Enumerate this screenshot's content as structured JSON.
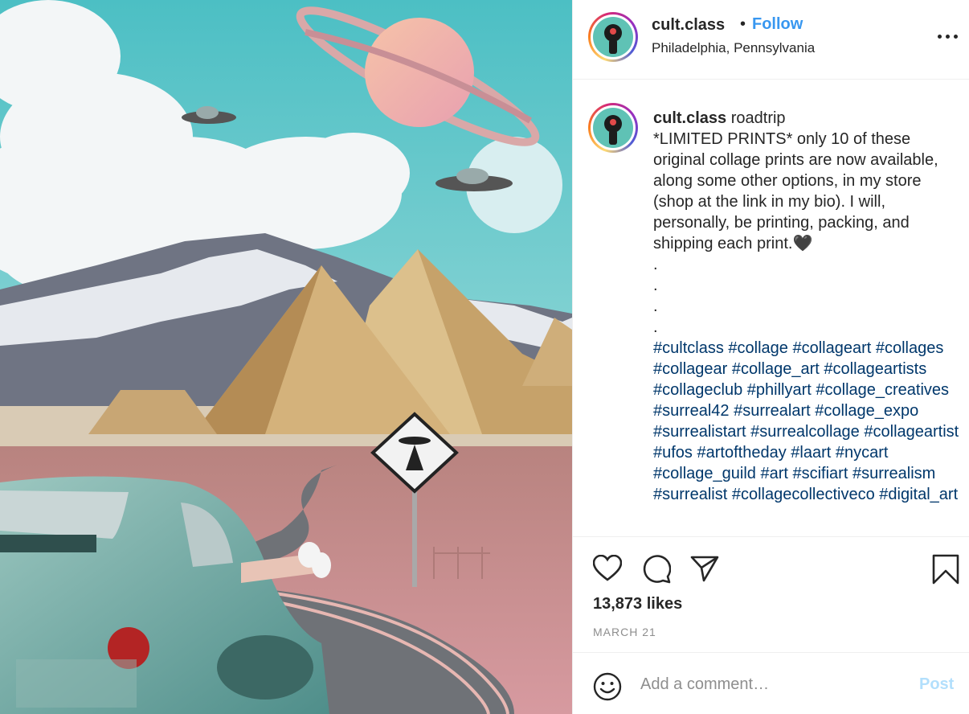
{
  "post": {
    "image_alt": "Surreal collage: vintage car on a desert road with pyramids, mountains, UFOs and Saturn",
    "image_colors": {
      "sky": "#52c1c6",
      "sand": "#d9b77f",
      "car": "#7fb3ad",
      "road_field": "#c7868c"
    }
  },
  "header": {
    "username": "cult.class",
    "separator": "•",
    "follow_label": "Follow",
    "location": "Philadelphia, Pennsylvania"
  },
  "caption": {
    "username": "cult.class",
    "text": " roadtrip\n*LIMITED PRINTS* only 10 of these original collage prints are now available, along some other options, in my store (shop at the link in my bio). I will, personally, be printing, packing, and shipping each print.🖤\n.\n.\n.\n.",
    "hashtags": [
      "#cultclass",
      "#collage",
      "#collageart",
      "#collages",
      "#collagear",
      "#collage_art",
      "#collageartists",
      "#collageclub",
      "#phillyart",
      "#collage_creatives",
      "#surreal42",
      "#surrealart",
      "#collage_expo",
      "#surrealistart",
      "#surrealcollage",
      "#collageartist",
      "#ufos",
      "#artoftheday",
      "#laart",
      "#nycart",
      "#collage_guild",
      "#art",
      "#scifiart",
      "#surrealism",
      "#surrealist",
      "#collagecollectiveco",
      "#digital_art"
    ]
  },
  "actions": {
    "icons": [
      "heart-icon",
      "comment-icon",
      "share-icon",
      "bookmark-icon"
    ],
    "likes": "13,873 likes",
    "date": "MARCH 21"
  },
  "comment_box": {
    "placeholder": "Add a comment…",
    "post_label": "Post",
    "emoji_icon": "smiley-icon"
  },
  "colors": {
    "link_blue": "#3897f0",
    "hashtag_blue": "#00376b",
    "muted_gray": "#8e8e8e",
    "post_disabled": "#b2dffc"
  }
}
